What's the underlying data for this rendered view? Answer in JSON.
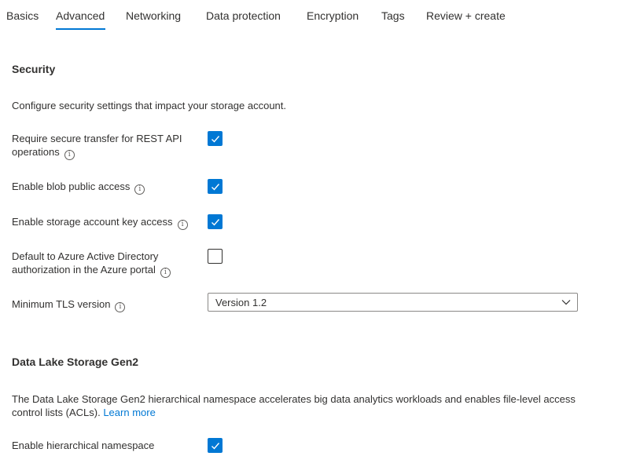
{
  "tabs": [
    {
      "label": "Basics"
    },
    {
      "label": "Advanced"
    },
    {
      "label": "Networking"
    },
    {
      "label": "Data protection"
    },
    {
      "label": "Encryption"
    },
    {
      "label": "Tags"
    },
    {
      "label": "Review + create"
    }
  ],
  "active_tab": "Advanced",
  "accent_color": "#0078d4",
  "security": {
    "title": "Security",
    "description": "Configure security settings that impact your storage account.",
    "fields": [
      {
        "label": "Require secure transfer for REST API operations",
        "checked": true,
        "has_info": true
      },
      {
        "label": "Enable blob public access",
        "checked": true,
        "has_info": true
      },
      {
        "label": "Enable storage account key access",
        "checked": true,
        "has_info": true
      },
      {
        "label": "Default to Azure Active Directory authorization in the Azure portal",
        "checked": false,
        "has_info": true
      }
    ],
    "tls": {
      "label": "Minimum TLS version",
      "value": "Version 1.2"
    }
  },
  "data_lake": {
    "title": "Data Lake Storage Gen2",
    "description": "The Data Lake Storage Gen2 hierarchical namespace accelerates big data analytics workloads and enables file-level access control lists (ACLs).",
    "learn_more": "Learn more",
    "field": {
      "label": "Enable hierarchical namespace",
      "checked": true
    }
  },
  "icons": {
    "info": "info-icon",
    "check": "checkmark-icon",
    "chevron": "chevron-down-icon"
  }
}
